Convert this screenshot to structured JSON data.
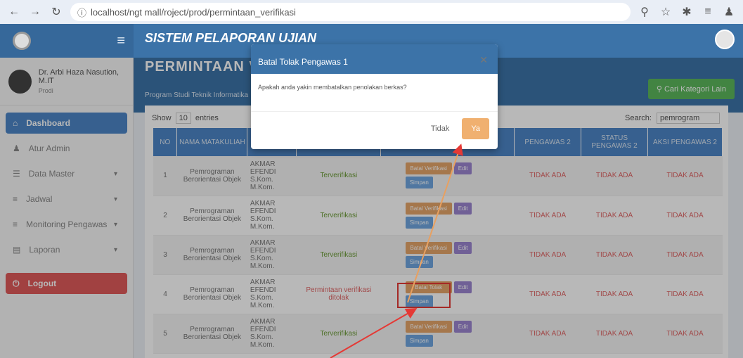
{
  "browser": {
    "url": "localhost/ngt mall/roject/prod/permintaan_verifikasi"
  },
  "app": {
    "title": "SISTEM PELAPORAN UJIAN"
  },
  "banner": {
    "title": "PERMINTAAN VERIFIKASI",
    "subtitle": "Program Studi Teknik Informatika",
    "cari_label": "Cari Kategori Lain"
  },
  "user": {
    "name": "Dr. Arbi Haza Nasution, M.IT",
    "role": "Prodi"
  },
  "sidebar": {
    "items": [
      {
        "label": "Dashboard"
      },
      {
        "label": "Atur Admin"
      },
      {
        "label": "Data Master"
      },
      {
        "label": "Jadwal"
      },
      {
        "label": "Monitoring Pengawas"
      },
      {
        "label": "Laporan"
      },
      {
        "label": "Logout"
      }
    ]
  },
  "table": {
    "show_label": "Show",
    "entries_value": "10",
    "entries_label": "entries",
    "search_label": "Search:",
    "search_value": "pemrogram",
    "headers": [
      "NO",
      "NAMA MATAKULIAH",
      "",
      "",
      "",
      "PENGAWAS 2",
      "STATUS PENGAWAS 2",
      "AKSI PENGAWAS 2"
    ],
    "rows": [
      {
        "no": "1",
        "matkul": "Pemrograman Berorientasi Objek",
        "pengawas": "AKMAR EFENDI S.Kom. M.Kom.",
        "status": "Terverifikasi",
        "peng2": "TIDAK ADA",
        "status2": "TIDAK ADA",
        "aksi2": "TIDAK ADA"
      },
      {
        "no": "2",
        "matkul": "Pemrograman Berorientasi Objek",
        "pengawas": "AKMAR EFENDI S.Kom. M.Kom.",
        "status": "Terverifikasi",
        "peng2": "TIDAK ADA",
        "status2": "TIDAK ADA",
        "aksi2": "TIDAK ADA"
      },
      {
        "no": "3",
        "matkul": "Pemrograman Berorientasi Objek",
        "pengawas": "AKMAR EFENDI S.Kom. M.Kom.",
        "status": "Terverifikasi",
        "peng2": "TIDAK ADA",
        "status2": "TIDAK ADA",
        "aksi2": "TIDAK ADA"
      },
      {
        "no": "4",
        "matkul": "Pemrograman Berorientasi Objek",
        "pengawas": "AKMAR EFENDI S.Kom. M.Kom.",
        "status": "Permintaan verifikasi ditolak",
        "peng2": "TIDAK ADA",
        "status2": "TIDAK ADA",
        "aksi2": "TIDAK ADA"
      },
      {
        "no": "5",
        "matkul": "Pemrograman Berorientasi Objek",
        "pengawas": "AKMAR EFENDI S.Kom. M.Kom.",
        "status": "Terverifikasi",
        "peng2": "TIDAK ADA",
        "status2": "TIDAK ADA",
        "aksi2": "TIDAK ADA"
      }
    ],
    "btn_batal_verif": "Batal Verifikasi",
    "btn_batal_tolak": "Batal Tolak",
    "btn_edit": "Edit",
    "btn_simpan": "Simpan"
  },
  "modal": {
    "title": "Batal Tolak Pengawas 1",
    "body": "Apakah anda yakin membatalkan penolakan berkas?",
    "cancel": "Tidak",
    "confirm": "Ya"
  }
}
